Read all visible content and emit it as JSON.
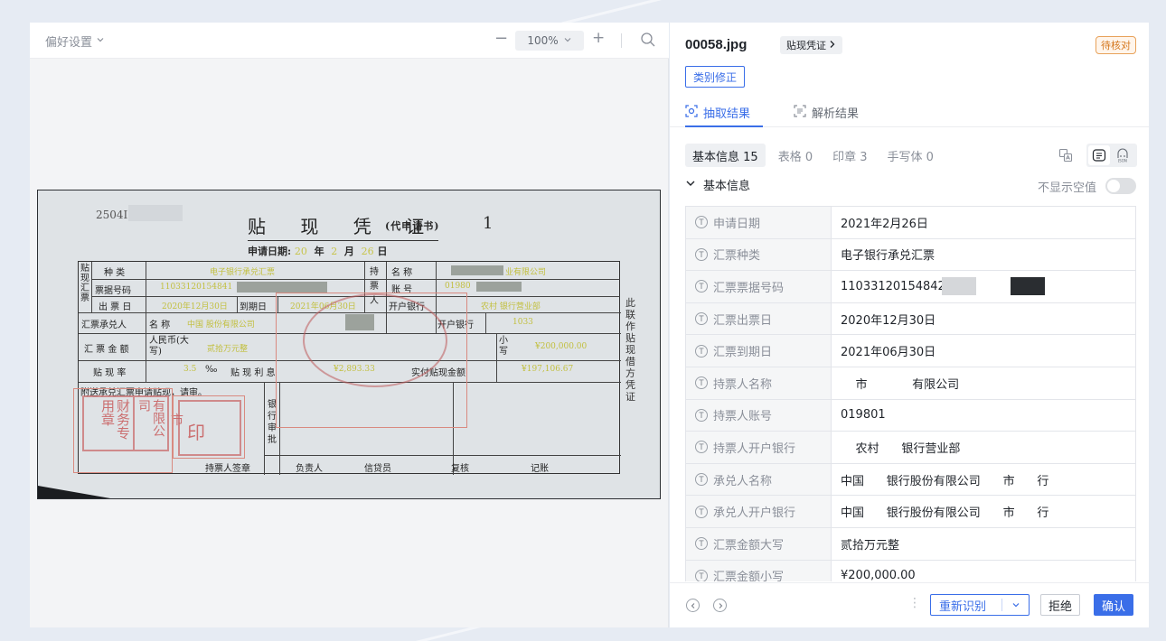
{
  "viewer": {
    "pref_label": "偏好设置",
    "zoom_level": "100%",
    "document": {
      "serial": "2504I",
      "title": "贴 现 凭 证",
      "title_sub": "(代申请书)",
      "number": "1",
      "date_label": "申请日期:",
      "date_year": "20",
      "date_year_unit": "年",
      "date_month": "2",
      "date_month_unit": "月",
      "date_day": "26",
      "date_day_unit": "日",
      "labels": {
        "tiexian_huipiao": "贴现汇票",
        "type": "种 类",
        "bill_no": "票据号码",
        "issue_date": "出 票 日",
        "due_date": "到期日",
        "holder": "持票人",
        "name": "名 称",
        "account": "账 号",
        "bank": "开户银行",
        "acceptor": "汇票承兑人",
        "acceptor_name": "名 称",
        "acceptor_bank": "开户银行",
        "amount": "汇 票 金 额",
        "rmb": "人民币(大写)",
        "small": "小写",
        "rate": "贴 现 率",
        "rate_unit": "‰",
        "interest": "贴 现 利 息",
        "actual": "实付贴现金额",
        "attach": "附送承兑汇票申请贴现，请审。",
        "bank_approve": "银行审批",
        "holder_sign": "持票人签章",
        "manager": "负责人",
        "credit": "信贷员",
        "review": "复核",
        "bookkeep": "记账",
        "side": "此联作贴现借方凭证"
      },
      "values": {
        "type": "电子银行承兑汇票",
        "bill_no": "11033120154841",
        "issue_date": "2020年12月30日",
        "due_date": "2021年06月30日",
        "holder_name": "业有限公司",
        "account": "01980",
        "bank": "农村    银行营业部",
        "acceptor_name": "中国        股份有限公司",
        "acceptor_bank": "1033",
        "amount_upper": "贰拾万元整",
        "amount_lower": "¥200,000.00",
        "rate": "3.5",
        "interest": "¥2,893.33",
        "actual": "¥197,106.67"
      },
      "stamps": {
        "finance": "财务专用章",
        "company": "有限公司",
        "city": "市",
        "seal": "印"
      }
    }
  },
  "panel": {
    "file_name": "00058.jpg",
    "category": "贴现凭证",
    "status": "待核对",
    "fix_button": "类别修正",
    "tabs": [
      {
        "label": "抽取结果"
      },
      {
        "label": "解析结果"
      }
    ],
    "subtabs": [
      {
        "label": "基本信息 15"
      },
      {
        "label": "表格 0"
      },
      {
        "label": "印章 3"
      },
      {
        "label": "手写体 0"
      }
    ],
    "section_title": "基本信息",
    "empty_toggle_label": "不显示空值",
    "fields": [
      {
        "label": "申请日期",
        "value": "2021年2月26日"
      },
      {
        "label": "汇票种类",
        "value": "电子银行承兑汇票"
      },
      {
        "label": "汇票票据号码",
        "value": "11033120154842"
      },
      {
        "label": "汇票出票日",
        "value": "2020年12月30日"
      },
      {
        "label": "汇票到期日",
        "value": "2021年06月30日"
      },
      {
        "label": "持票人名称",
        "value": "    市            有限公司"
      },
      {
        "label": "持票人账号",
        "value": "019801"
      },
      {
        "label": "持票人开户银行",
        "value": "    农村      银行营业部"
      },
      {
        "label": "承兑人名称",
        "value": "中国      银行股份有限公司      市      行"
      },
      {
        "label": "承兑人开户银行",
        "value": "中国      银行股份有限公司      市      行"
      },
      {
        "label": "汇票金额大写",
        "value": "贰拾万元整"
      },
      {
        "label": "汇票金额小写",
        "value": "¥200,000.00"
      }
    ],
    "footer": {
      "recognize": "重新识别",
      "reject": "拒绝",
      "confirm": "确认"
    }
  }
}
